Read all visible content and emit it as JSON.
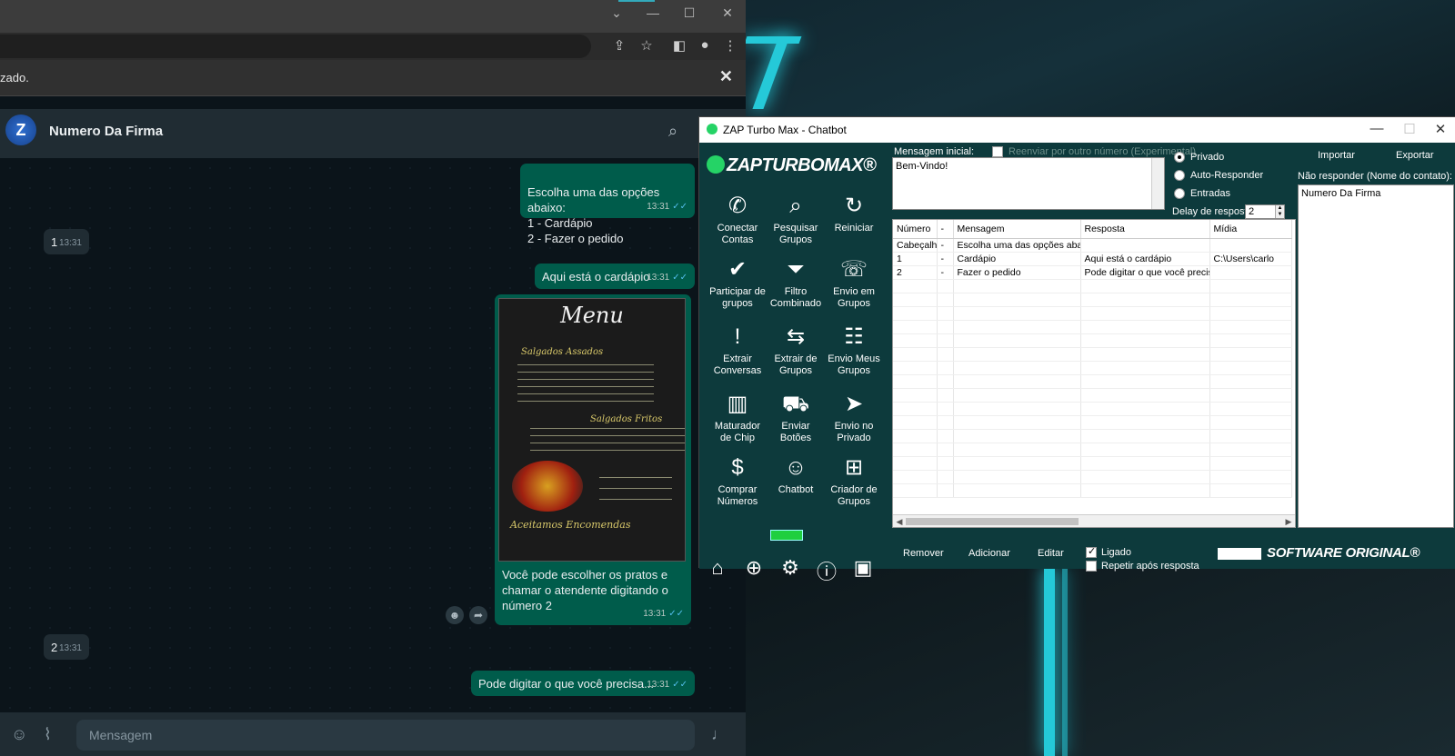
{
  "browser": {
    "info_bar_text": "zado.",
    "info_close": "✕",
    "window_controls": [
      "⌄",
      "—",
      "☐",
      "✕"
    ],
    "toolbar_icons": [
      "share-icon",
      "star-icon",
      "sidepanel-icon",
      "profile-icon",
      "menu-icon"
    ]
  },
  "whatsapp": {
    "contact_name": "Numero Da Firma",
    "avatar_letter": "Z",
    "input_placeholder": "Mensagem",
    "messages": [
      {
        "dir": "out",
        "text": "Escolha uma das opções abaixo:\n1 - Cardápio\n2 - Fazer o pedido",
        "time": "13:31"
      },
      {
        "dir": "in",
        "text": "1",
        "time": "13:31"
      },
      {
        "dir": "out",
        "text": "Aqui está o cardápio",
        "time": "13:31"
      },
      {
        "dir": "out",
        "text": "Você pode escolher os pratos e chamar o atendente digitando o número 2",
        "time": "13:31"
      },
      {
        "dir": "in",
        "text": "2",
        "time": "13:31"
      },
      {
        "dir": "out",
        "text": "Pode digitar o que você precisa...",
        "time": "13:31"
      }
    ],
    "menu_image": {
      "title": "Menu",
      "section1": "Salgados Assados",
      "section2": "Salgados Fritos",
      "footer": "Aceitamos Encomendas"
    }
  },
  "zap": {
    "window_title": "ZAP Turbo Max - Chatbot",
    "logo_text": "ZAPTURBOMAX®",
    "sidebar_buttons": [
      {
        "icon": "✆",
        "label": "Conectar Contas",
        "name": "conectar-contas"
      },
      {
        "icon": "⌕",
        "label": "Pesquisar Grupos",
        "name": "pesquisar-grupos"
      },
      {
        "icon": "↻",
        "label": "Reiniciar",
        "name": "reiniciar"
      },
      {
        "icon": "✔",
        "label": "Participar de grupos",
        "name": "participar-grupos"
      },
      {
        "icon": "⏷",
        "label": "Filtro Combinado",
        "name": "filtro-combinado"
      },
      {
        "icon": "☏",
        "label": "Envio em Grupos",
        "name": "envio-grupos"
      },
      {
        "icon": "!",
        "label": "Extrair Conversas",
        "name": "extrair-conversas"
      },
      {
        "icon": "⇆",
        "label": "Extrair de Grupos",
        "name": "extrair-grupos"
      },
      {
        "icon": "☷",
        "label": "Envio Meus Grupos",
        "name": "envio-meus-grupos"
      },
      {
        "icon": "▥",
        "label": "Maturador de Chip",
        "name": "maturador-chip"
      },
      {
        "icon": "⛟",
        "label": "Enviar Botões",
        "name": "enviar-botoes"
      },
      {
        "icon": "➤",
        "label": "Envio no Privado",
        "name": "envio-privado"
      },
      {
        "icon": "$",
        "label": "Comprar Números",
        "name": "comprar-numeros"
      },
      {
        "icon": "☺",
        "label": "Chatbot",
        "name": "chatbot"
      },
      {
        "icon": "⊞",
        "label": "Criador de Grupos",
        "name": "criador-grupos"
      }
    ],
    "footer_icons": [
      "⌂",
      "⊕",
      "⚙",
      "ⓘ",
      "▣"
    ],
    "labels": {
      "mensagem_inicial": "Mensagem inicial:",
      "reenviar": "Reenviar por outro número (Experimental)",
      "privado": "Privado",
      "auto_responder": "Auto-Responder",
      "entradas": "Entradas",
      "delay": "Delay de resposta:",
      "importar": "Importar",
      "exportar": "Exportar",
      "nao_responder": "Não responder (Nome do contato):",
      "remover": "Remover",
      "adicionar": "Adicionar",
      "editar": "Editar",
      "ligado": "Ligado",
      "repetir": "Repetir após resposta",
      "software_original": "SOFTWARE ORIGINAL®"
    },
    "mensagem_inicial_value": "Bem-Vindo!",
    "delay_value": "2",
    "nao_responder_value": "Numero Da Firma",
    "grid": {
      "columns": [
        "Número",
        "-",
        "Mensagem",
        "Resposta",
        "Mídia"
      ],
      "rows": [
        [
          "Cabeçalho",
          "-",
          "Escolha uma das opções abaixo:",
          "",
          ""
        ],
        [
          "1",
          "-",
          "Cardápio",
          "Aqui está o cardápio",
          "C:\\Users\\carlo"
        ],
        [
          "2",
          "-",
          "Fazer o pedido",
          "Pode digitar o que você precisa...",
          ""
        ]
      ]
    }
  }
}
